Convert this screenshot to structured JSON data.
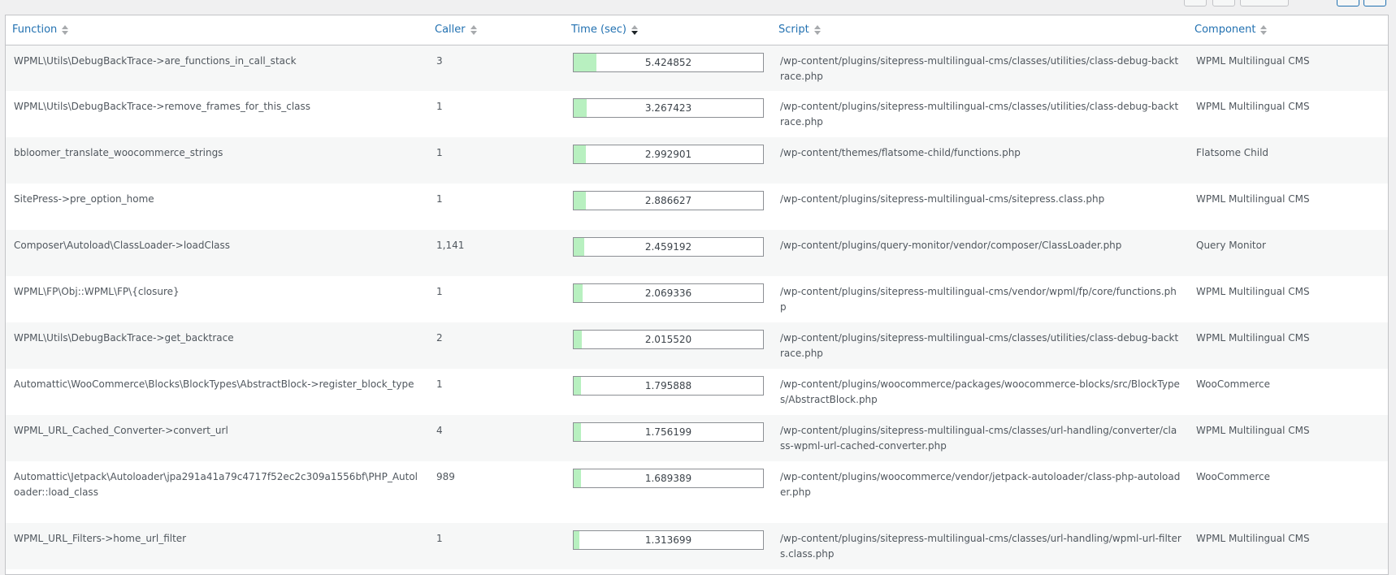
{
  "header": {
    "function": "Function",
    "caller": "Caller",
    "time": "Time (sec)",
    "script": "Script",
    "component": "Component"
  },
  "rows": [
    {
      "function": "WPML\\Utils\\DebugBackTrace->are_functions_in_call_stack",
      "caller": "3",
      "time": "5.424852",
      "time_fraction": 0.12,
      "script": "/wp-content/plugins/sitepress-multilingual-cms/classes/utilities/class-debug-backtrace.php",
      "component": "WPML Multilingual CMS"
    },
    {
      "function": "WPML\\Utils\\DebugBackTrace->remove_frames_for_this_class",
      "caller": "1",
      "time": "3.267423",
      "time_fraction": 0.07,
      "script": "/wp-content/plugins/sitepress-multilingual-cms/classes/utilities/class-debug-backtrace.php",
      "component": "WPML Multilingual CMS"
    },
    {
      "function": "bbloomer_translate_woocommerce_strings",
      "caller": "1",
      "time": "2.992901",
      "time_fraction": 0.065,
      "script": "/wp-content/themes/flatsome-child/functions.php",
      "component": "Flatsome Child"
    },
    {
      "function": "SitePress->pre_option_home",
      "caller": "1",
      "time": "2.886627",
      "time_fraction": 0.063,
      "script": "/wp-content/plugins/sitepress-multilingual-cms/sitepress.class.php",
      "component": "WPML Multilingual CMS"
    },
    {
      "function": "Composer\\Autoload\\ClassLoader->loadClass",
      "caller": "1,141",
      "time": "2.459192",
      "time_fraction": 0.055,
      "script": "/wp-content/plugins/query-monitor/vendor/composer/ClassLoader.php",
      "component": "Query Monitor"
    },
    {
      "function": "WPML\\FP\\Obj::WPML\\FP\\{closure}",
      "caller": "1",
      "time": "2.069336",
      "time_fraction": 0.046,
      "script": "/wp-content/plugins/sitepress-multilingual-cms/vendor/wpml/fp/core/functions.php",
      "component": "WPML Multilingual CMS"
    },
    {
      "function": "WPML\\Utils\\DebugBackTrace->get_backtrace",
      "caller": "2",
      "time": "2.015520",
      "time_fraction": 0.045,
      "script": "/wp-content/plugins/sitepress-multilingual-cms/classes/utilities/class-debug-backtrace.php",
      "component": "WPML Multilingual CMS"
    },
    {
      "function": "Automattic\\WooCommerce\\Blocks\\BlockTypes\\AbstractBlock->register_block_type",
      "caller": "1",
      "time": "1.795888",
      "time_fraction": 0.04,
      "script": "/wp-content/plugins/woocommerce/packages/woocommerce-blocks/src/BlockTypes/AbstractBlock.php",
      "component": "WooCommerce"
    },
    {
      "function": "WPML_URL_Cached_Converter->convert_url",
      "caller": "4",
      "time": "1.756199",
      "time_fraction": 0.039,
      "script": "/wp-content/plugins/sitepress-multilingual-cms/classes/url-handling/converter/class-wpml-url-cached-converter.php",
      "component": "WPML Multilingual CMS"
    },
    {
      "function": "Automattic\\Jetpack\\Autoloader\\jpa291a41a79c4717f52ec2c309a1556bf\\PHP_Autoloader::load_class",
      "caller": "989",
      "time": "1.689389",
      "time_fraction": 0.038,
      "script": "/wp-content/plugins/woocommerce/vendor/jetpack-autoloader/class-php-autoloader.php",
      "component": "WooCommerce",
      "tall": true
    },
    {
      "function": "WPML_URL_Filters->home_url_filter",
      "caller": "1",
      "time": "1.313699",
      "time_fraction": 0.03,
      "script": "/wp-content/plugins/sitepress-multilingual-cms/classes/url-handling/wpml-url-filters.class.php",
      "component": "WPML Multilingual CMS"
    }
  ]
}
